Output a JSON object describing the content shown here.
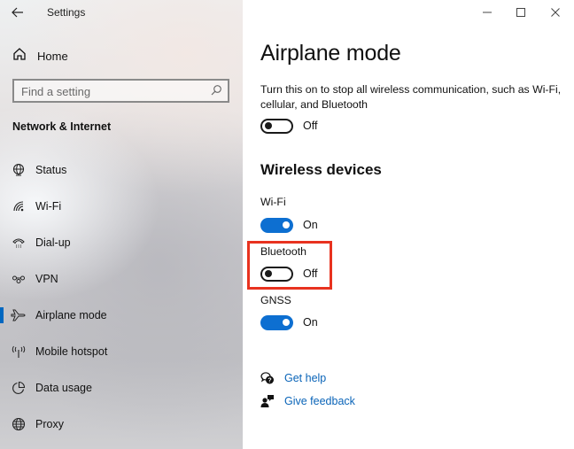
{
  "window": {
    "title": "Settings",
    "back_icon": "back-arrow-icon",
    "controls": [
      "minimize-icon",
      "maximize-icon",
      "close-icon"
    ]
  },
  "sidebar": {
    "home_label": "Home",
    "search": {
      "placeholder": "Find a setting",
      "value": ""
    },
    "section_header": "Network & Internet",
    "items": [
      {
        "label": "Status",
        "icon": "status-globe-icon",
        "selected": false
      },
      {
        "label": "Wi-Fi",
        "icon": "wifi-icon",
        "selected": false
      },
      {
        "label": "Dial-up",
        "icon": "dial-up-phone-icon",
        "selected": false
      },
      {
        "label": "VPN",
        "icon": "vpn-icon",
        "selected": false
      },
      {
        "label": "Airplane mode",
        "icon": "airplane-icon",
        "selected": true
      },
      {
        "label": "Mobile hotspot",
        "icon": "hotspot-icon",
        "selected": false
      },
      {
        "label": "Data usage",
        "icon": "data-usage-icon",
        "selected": false
      },
      {
        "label": "Proxy",
        "icon": "proxy-globe-icon",
        "selected": false
      }
    ]
  },
  "main": {
    "title": "Airplane mode",
    "description": "Turn this on to stop all wireless communication, such as Wi-Fi, cellular, and Bluetooth",
    "airplane_toggle": {
      "state": "Off",
      "on": false
    },
    "wireless_section_title": "Wireless devices",
    "devices": [
      {
        "label": "Wi-Fi",
        "state": "On",
        "on": true
      },
      {
        "label": "Bluetooth",
        "state": "Off",
        "on": false,
        "highlighted": true
      },
      {
        "label": "GNSS",
        "state": "On",
        "on": true
      }
    ],
    "links": [
      {
        "label": "Get help",
        "icon": "get-help-icon"
      },
      {
        "label": "Give feedback",
        "icon": "give-feedback-icon"
      }
    ]
  },
  "colors": {
    "accent": "#0d6fd1",
    "link": "#0a64b8",
    "highlight_border": "#e8321f"
  }
}
